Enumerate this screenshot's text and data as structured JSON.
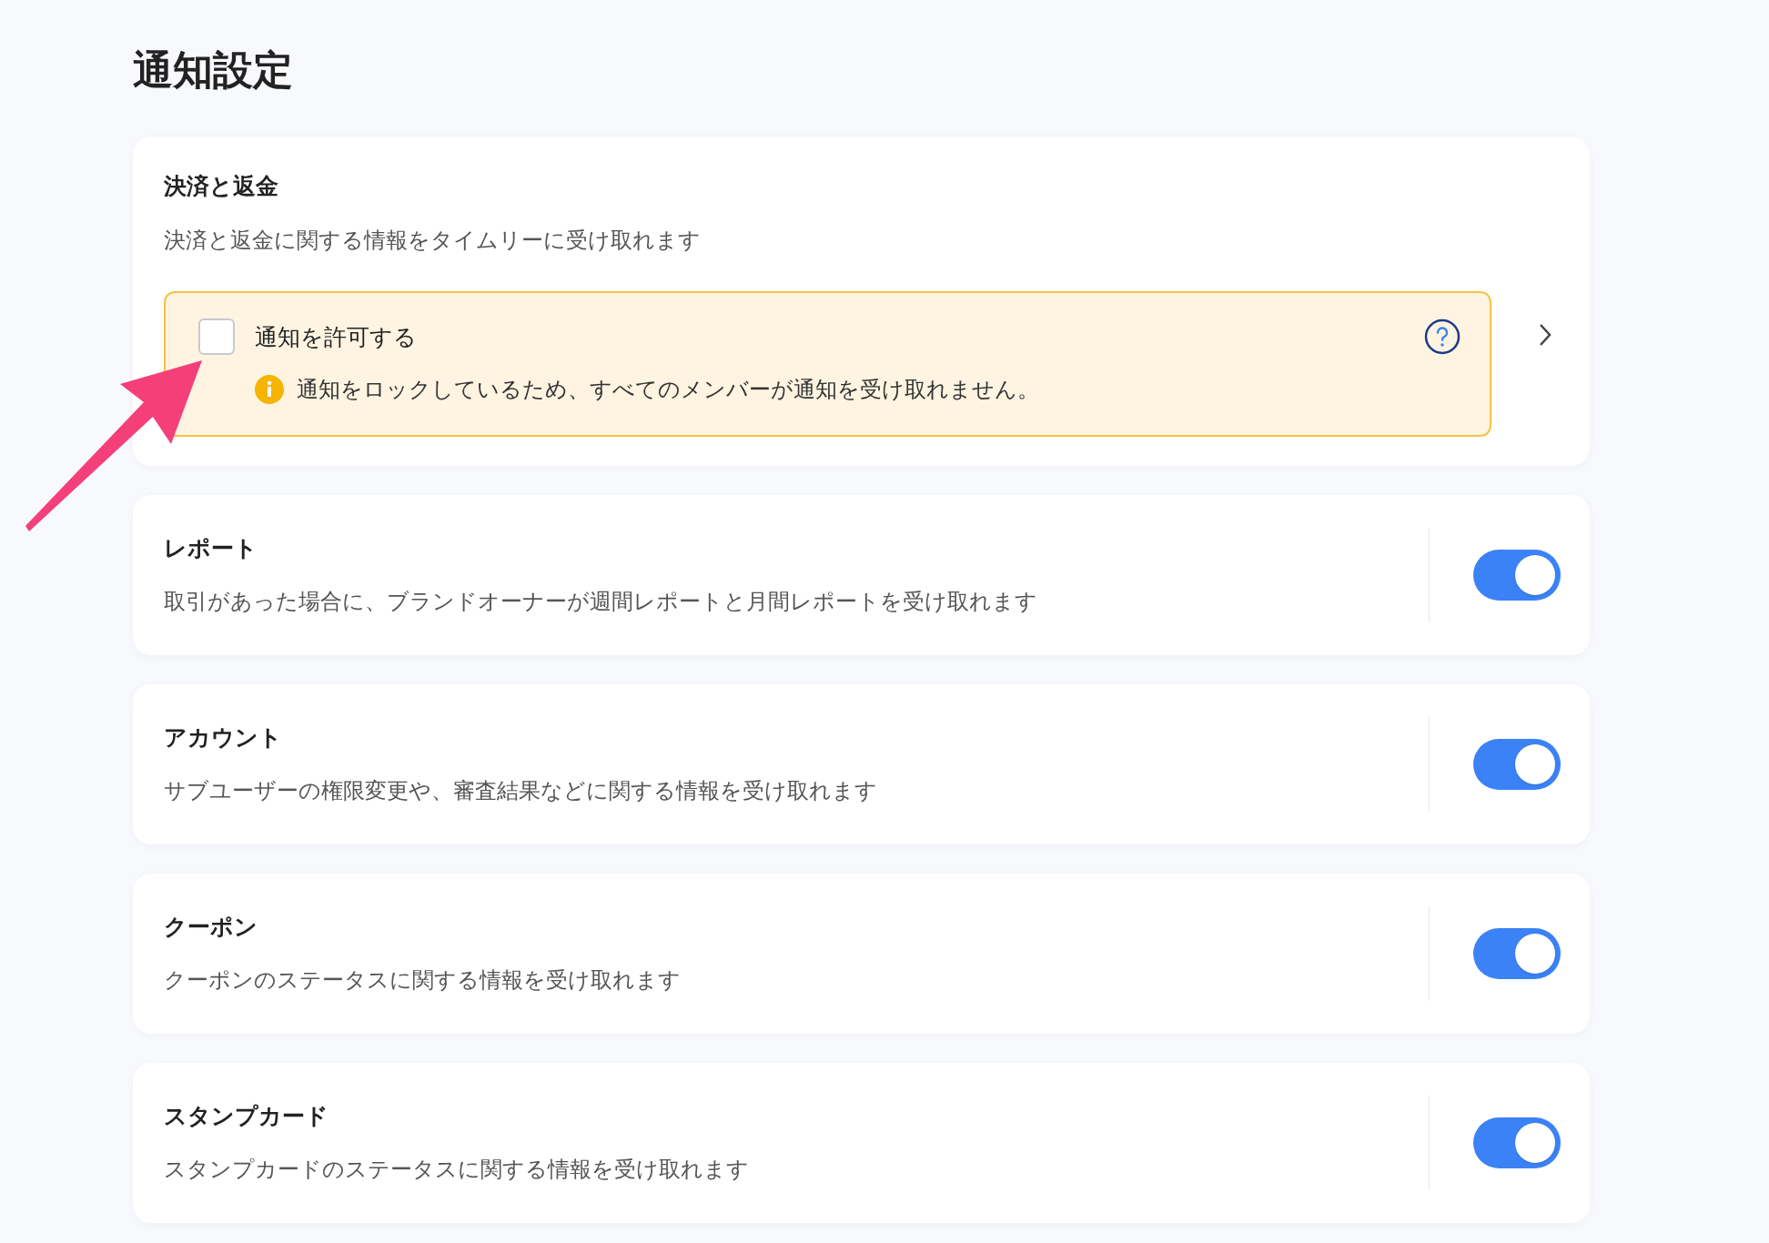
{
  "page": {
    "title": "通知設定"
  },
  "sections": [
    {
      "kind": "detail",
      "title": "決済と返金",
      "description": "決済と返金に関する情報をタイムリーに受け取れます",
      "notice": {
        "label": "通知を許可する",
        "checked": false,
        "warning": "通知をロックしているため、すべてのメンバーが通知を受け取れません。"
      }
    },
    {
      "kind": "toggle",
      "title": "レポート",
      "description": "取引があった場合に、ブランドオーナーが週間レポートと月間レポートを受け取れます",
      "on": true
    },
    {
      "kind": "toggle",
      "title": "アカウント",
      "description": "サブユーザーの権限変更や、審査結果などに関する情報を受け取れます",
      "on": true
    },
    {
      "kind": "toggle",
      "title": "クーポン",
      "description": "クーポンのステータスに関する情報を受け取れます",
      "on": true
    },
    {
      "kind": "toggle",
      "title": "スタンプカード",
      "description": "スタンプカードのステータスに関する情報を受け取れます",
      "on": true
    }
  ]
}
